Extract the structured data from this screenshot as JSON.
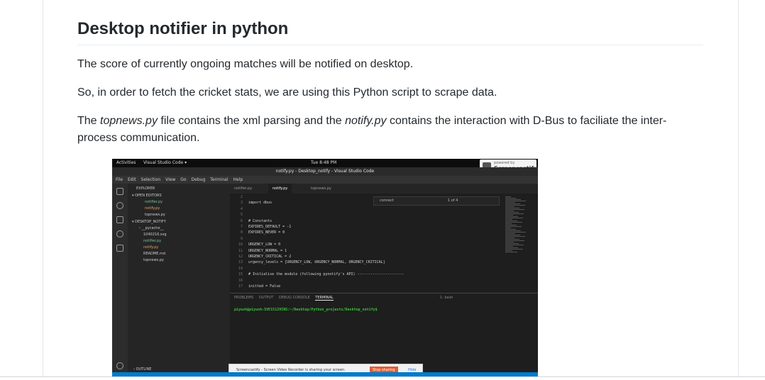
{
  "article": {
    "heading": "Desktop notifier in python",
    "p1": "The score of currently ongoing matches will be notified on desktop.",
    "p2": "So, in order to fetch the cricket stats, we are using this Python script to scrape data.",
    "p3_a": "The ",
    "p3_file1": "topnews.py",
    "p3_b": " file contains the xml parsing and the ",
    "p3_file2": "notify.py",
    "p3_c": " contains the interaction with D-Bus to faciliate the inter-process communication."
  },
  "screenshot": {
    "gnome": {
      "activities": "Activities",
      "app": "Visual Studio Code ▾",
      "clock": "Tue 8:48 PM"
    },
    "watermark": {
      "small": "powered by",
      "big": "Screencastify"
    },
    "window_title": "notify.py - Desktop_notify - Visual Studio Code",
    "menu": [
      "File",
      "Edit",
      "Selection",
      "View",
      "Go",
      "Debug",
      "Terminal",
      "Help"
    ],
    "explorer": {
      "title": "EXPLORER",
      "open_editors": "▾ OPEN EDITORS",
      "open_files": [
        "notifier.py",
        "notify.py",
        "topnews.py"
      ],
      "project": "▾ DESKTOP_NOTIFY",
      "files": [
        "› __pycache__",
        "1040216.svg",
        "notifier.py",
        "notify.py",
        "README.md",
        "topnews.py"
      ],
      "outline": "› OUTLINE"
    },
    "tabs": [
      "notifier.py",
      "notify.py",
      "topnews.py"
    ],
    "find": {
      "query": "connect",
      "count": "1 of 4"
    },
    "code": [
      {
        "n": "2",
        "t": ""
      },
      {
        "n": "3",
        "t": "import dbus"
      },
      {
        "n": "4",
        "t": ""
      },
      {
        "n": "5",
        "t": ""
      },
      {
        "n": "6",
        "t": "# Constants"
      },
      {
        "n": "7",
        "t": "EXPIRES_DEFAULT = -1"
      },
      {
        "n": "8",
        "t": "EXPIRES_NEVER = 0"
      },
      {
        "n": "9",
        "t": ""
      },
      {
        "n": "10",
        "t": "URGENCY_LOW = 0"
      },
      {
        "n": "11",
        "t": "URGENCY_NORMAL = 1"
      },
      {
        "n": "12",
        "t": "URGENCY_CRITICAL = 2"
      },
      {
        "n": "13",
        "t": "urgency_levels = [URGENCY_LOW, URGENCY_NORMAL, URGENCY_CRITICAL]"
      },
      {
        "n": "14",
        "t": ""
      },
      {
        "n": "15",
        "t": "# Initialise the module (following pynotify's API) ----------------------"
      },
      {
        "n": "16",
        "t": ""
      },
      {
        "n": "17",
        "t": "initted = False"
      }
    ],
    "panel_tabs": [
      "PROBLEMS",
      "OUTPUT",
      "DEBUG CONSOLE",
      "TERMINAL"
    ],
    "shell": "1: bash",
    "prompt": "piyush@piyush-SVE15129CNS:~/Desktop/Python_projects/Desktop_notify$",
    "share": {
      "message": "Screencastify - Screen Video Recorder is sharing your screen.",
      "stop": "Stop sharing",
      "hide": "Hide"
    }
  }
}
